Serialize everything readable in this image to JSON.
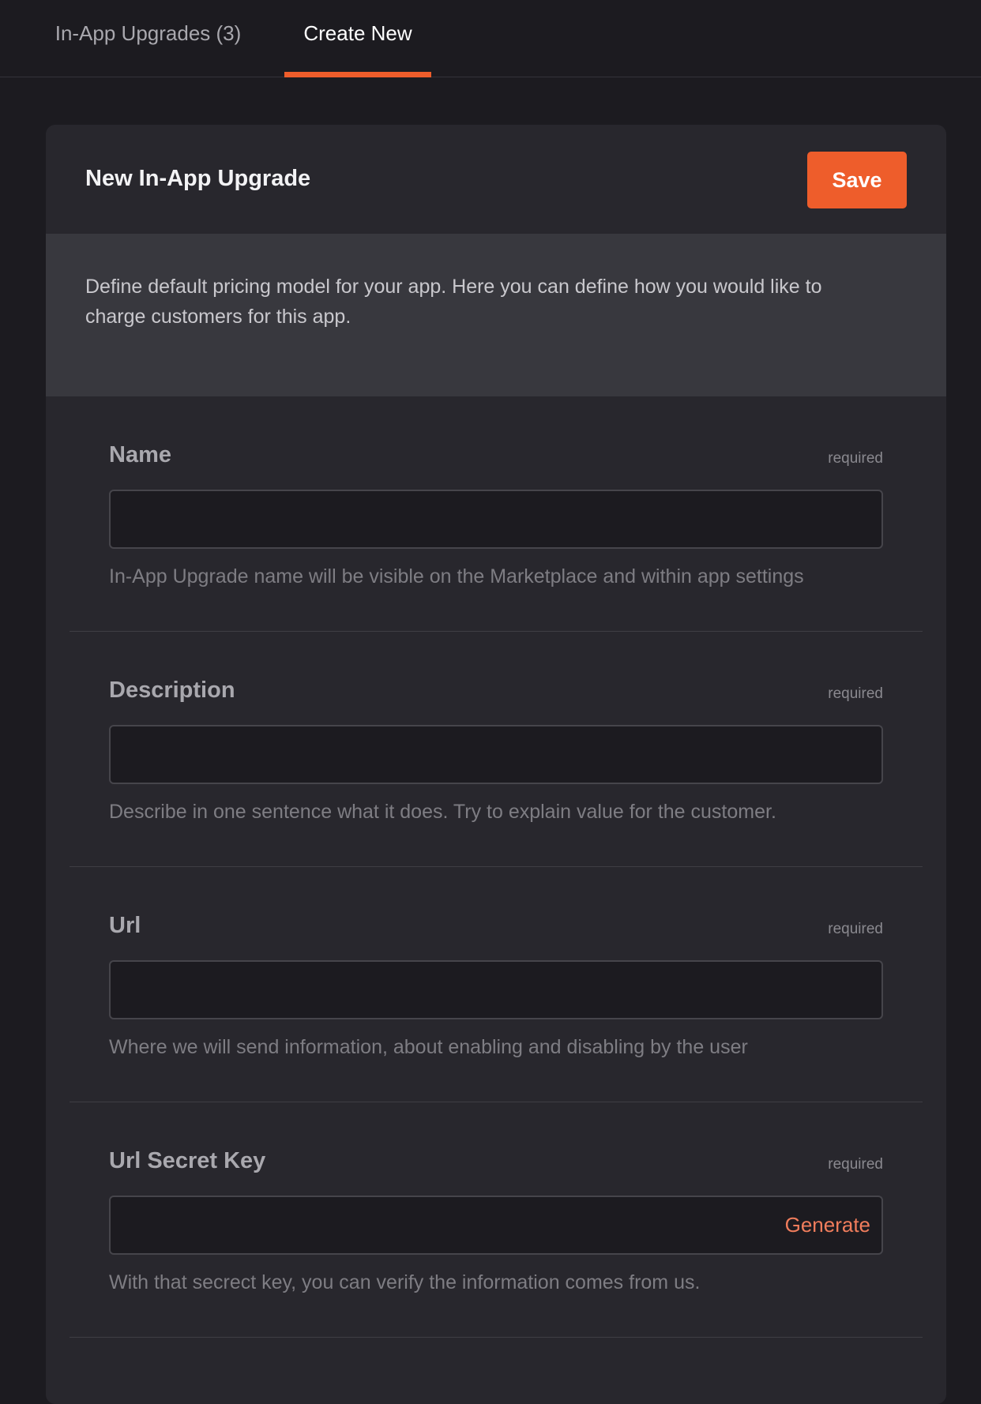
{
  "tabs": [
    {
      "label": "In-App Upgrades (3)",
      "active": false
    },
    {
      "label": "Create New",
      "active": true
    }
  ],
  "card": {
    "title": "New In-App Upgrade",
    "save_label": "Save",
    "intro": "Define default pricing model for your app. Here you can define how you would like to charge customers for this app."
  },
  "fields": [
    {
      "label": "Name",
      "required_label": "required",
      "value": "",
      "help": "In-App Upgrade name will be visible on the Marketplace and within app settings"
    },
    {
      "label": "Description",
      "required_label": "required",
      "value": "",
      "help": "Describe in one sentence what it does. Try to explain value for the customer."
    },
    {
      "label": "Url",
      "required_label": "required",
      "value": "",
      "help": "Where we will send information, about enabling and disabling by the user"
    },
    {
      "label": "Url Secret Key",
      "required_label": "required",
      "value": "",
      "action_label": "Generate",
      "help": "With that secrect key, you can verify the information comes from us."
    }
  ],
  "colors": {
    "accent": "#ee5d2b",
    "background": "#1c1b20",
    "card": "#28272d",
    "intro_band": "#38383e"
  }
}
